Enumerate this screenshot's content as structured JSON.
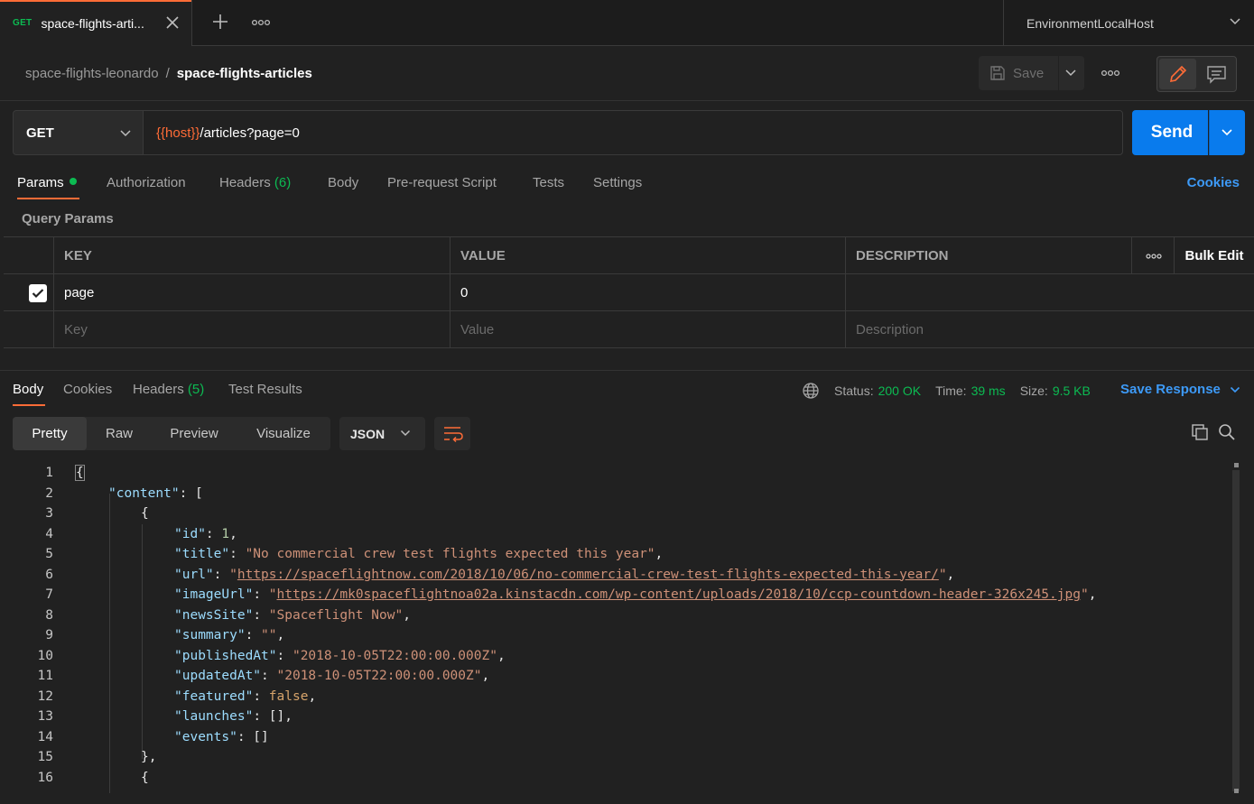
{
  "tab": {
    "method": "GET",
    "name": "space-flights-arti..."
  },
  "environment": {
    "name": "EnvironmentLocalHost"
  },
  "breadcrumb": {
    "collection": "space-flights-leonardo",
    "separator": "/",
    "request": "space-flights-articles"
  },
  "toolbar": {
    "save_label": "Save"
  },
  "request": {
    "method": "GET",
    "url_variable": "{{host}}",
    "url_path": "/articles?page=0",
    "send_label": "Send"
  },
  "request_tabs": {
    "params": "Params",
    "authorization": "Authorization",
    "headers": "Headers",
    "headers_count": "(6)",
    "body": "Body",
    "prerequest": "Pre-request Script",
    "tests": "Tests",
    "settings": "Settings",
    "cookies": "Cookies"
  },
  "query_params": {
    "title": "Query Params",
    "headers": {
      "key": "KEY",
      "value": "VALUE",
      "description": "DESCRIPTION",
      "bulk_edit": "Bulk Edit"
    },
    "rows": [
      {
        "checked": true,
        "key": "page",
        "value": "0",
        "description": ""
      }
    ],
    "placeholders": {
      "key": "Key",
      "value": "Value",
      "description": "Description"
    }
  },
  "response_tabs": {
    "body": "Body",
    "cookies": "Cookies",
    "headers": "Headers",
    "headers_count": "(5)",
    "test_results": "Test Results"
  },
  "response_status": {
    "status_label": "Status:",
    "status_value": "200 OK",
    "time_label": "Time:",
    "time_value": "39 ms",
    "size_label": "Size:",
    "size_value": "9.5 KB",
    "save_response": "Save Response"
  },
  "response_view": {
    "modes": [
      "Pretty",
      "Raw",
      "Preview",
      "Visualize"
    ],
    "active_mode": "Pretty",
    "language": "JSON"
  },
  "code_lines": [
    {
      "n": "1",
      "text": "{"
    },
    {
      "n": "2",
      "key": "\"content\"",
      "rest": ": ["
    },
    {
      "n": "3",
      "text": "{"
    },
    {
      "n": "4",
      "key": "\"id\"",
      "num": "1",
      "tail": ","
    },
    {
      "n": "5",
      "key": "\"title\"",
      "str": "\"No commercial crew test flights expected this year\"",
      "tail": ","
    },
    {
      "n": "6",
      "key": "\"url\"",
      "q1": "\"",
      "link": "https://spaceflightnow.com/2018/10/06/no-commercial-crew-test-flights-expected-this-year/",
      "q2": "\"",
      "tail": ","
    },
    {
      "n": "7",
      "key": "\"imageUrl\"",
      "q1": "\"",
      "link": "https://mk0spaceflightnoa02a.kinstacdn.com/wp-content/uploads/2018/10/ccp-countdown-header-326x245.jpg",
      "q2": "\"",
      "tail": ","
    },
    {
      "n": "8",
      "key": "\"newsSite\"",
      "str": "\"Spaceflight Now\"",
      "tail": ","
    },
    {
      "n": "9",
      "key": "\"summary\"",
      "str": "\"\"",
      "tail": ","
    },
    {
      "n": "10",
      "key": "\"publishedAt\"",
      "str": "\"2018-10-05T22:00:00.000Z\"",
      "tail": ","
    },
    {
      "n": "11",
      "key": "\"updatedAt\"",
      "str": "\"2018-10-05T22:00:00.000Z\"",
      "tail": ","
    },
    {
      "n": "12",
      "key": "\"featured\"",
      "bool": "false",
      "tail": ","
    },
    {
      "n": "13",
      "key": "\"launches\"",
      "rest": ": [],"
    },
    {
      "n": "14",
      "key": "\"events\"",
      "rest": ": []"
    },
    {
      "n": "15",
      "text": "},"
    },
    {
      "n": "16",
      "text": "{"
    }
  ]
}
